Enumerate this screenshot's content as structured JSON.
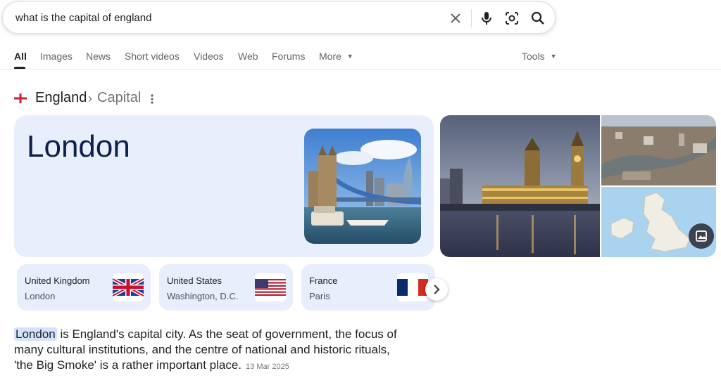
{
  "search": {
    "query": "what is the capital of england",
    "icons": [
      "close-icon",
      "mic-icon",
      "lens-icon",
      "search-icon"
    ]
  },
  "tabs": [
    {
      "label": "All",
      "active": true
    },
    {
      "label": "Images"
    },
    {
      "label": "News"
    },
    {
      "label": "Short videos"
    },
    {
      "label": "Videos"
    },
    {
      "label": "Web"
    },
    {
      "label": "Forums"
    },
    {
      "label": "More"
    }
  ],
  "tools_label": "Tools",
  "breadcrumb": {
    "entity": "England",
    "separator": "›",
    "attribute": "Capital"
  },
  "answer": {
    "title": "London"
  },
  "related": [
    {
      "name": "United Kingdom",
      "capital": "London",
      "flag": "uk-flag"
    },
    {
      "name": "United States",
      "capital": "Washington, D.C.",
      "flag": "us-flag"
    },
    {
      "name": "France",
      "capital": "Paris",
      "flag": "france-flag"
    }
  ],
  "description": {
    "highlight": "London",
    "line1": " is England's capital city. As the seat of government, the focus of",
    "line2": "many cultural institutions, and the centre of national and historic rituals,",
    "line3": "'the Big Smoke' is a rather important place.",
    "date": "13 Mar 2025"
  },
  "colors": {
    "card_bg": "#e8eefb",
    "highlight": "#d3e3fd",
    "answer_text": "#10204a"
  }
}
